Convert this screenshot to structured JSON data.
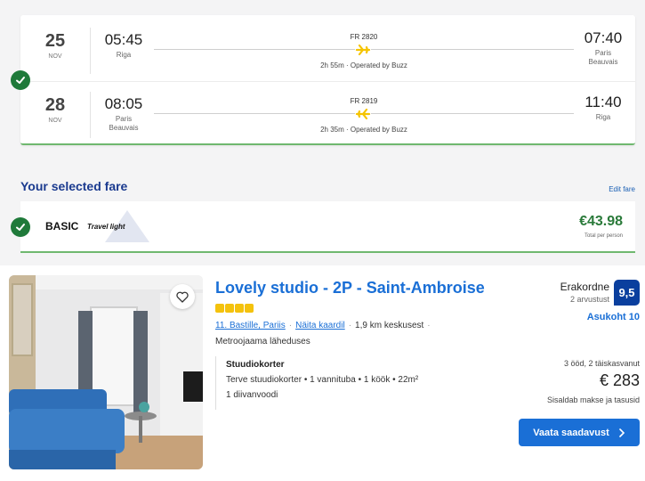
{
  "flights": [
    {
      "date_day": "25",
      "date_month": "NOV",
      "dep_time": "05:45",
      "dep_place": "Riga",
      "flight_no": "FR 2820",
      "duration": "2h 55m · Operated by Buzz",
      "arr_time": "07:40",
      "arr_place_line1": "Paris",
      "arr_place_line2": "Beauvais"
    },
    {
      "date_day": "28",
      "date_month": "NOV",
      "dep_time": "08:05",
      "dep_place_line1": "Paris",
      "dep_place_line2": "Beauvais",
      "flight_no": "FR 2819",
      "duration": "2h 35m · Operated by Buzz",
      "arr_time": "11:40",
      "arr_place": "Riga"
    }
  ],
  "fare": {
    "section_title": "Your selected fare",
    "edit_label": "Edit fare",
    "name": "BASIC",
    "subtitle": "Travel light",
    "price": "€43.98",
    "price_note": "Total per person"
  },
  "hotel": {
    "name": "Lovely studio - 2P - Saint-Ambroise",
    "star_count": 4,
    "location_link": "11. Bastille, Pariis",
    "map_link": "Näita kaardil",
    "distance": "1,9 km keskusest",
    "metro": "Metroojaama läheduses",
    "room_type": "Stuudiokorter",
    "room_desc": "Terve stuudiokorter • 1 vannituba • 1 köök • 22m²",
    "room_bed": "1 diivanvoodi",
    "rating_word": "Erakordne",
    "rating_count": "2 arvustust",
    "rating_score": "9,5",
    "location_score": "Asukoht 10",
    "stay_info": "3 ööd, 2 täiskasvanut",
    "price": "€ 283",
    "tax_note": "Sisaldab makse ja tasusid",
    "cta_label": "Vaata saadavust"
  },
  "colors": {
    "accent_blue": "#1a6fd6",
    "check_green": "#1f7a3a",
    "price_green": "#2a7a3a",
    "badge_navy": "#0a3f9e",
    "star_yellow": "#f4c20d",
    "plane_yellow": "#f5c400"
  },
  "icons": [
    "check-icon",
    "plane-icon",
    "heart-icon",
    "chevron-right-icon"
  ]
}
